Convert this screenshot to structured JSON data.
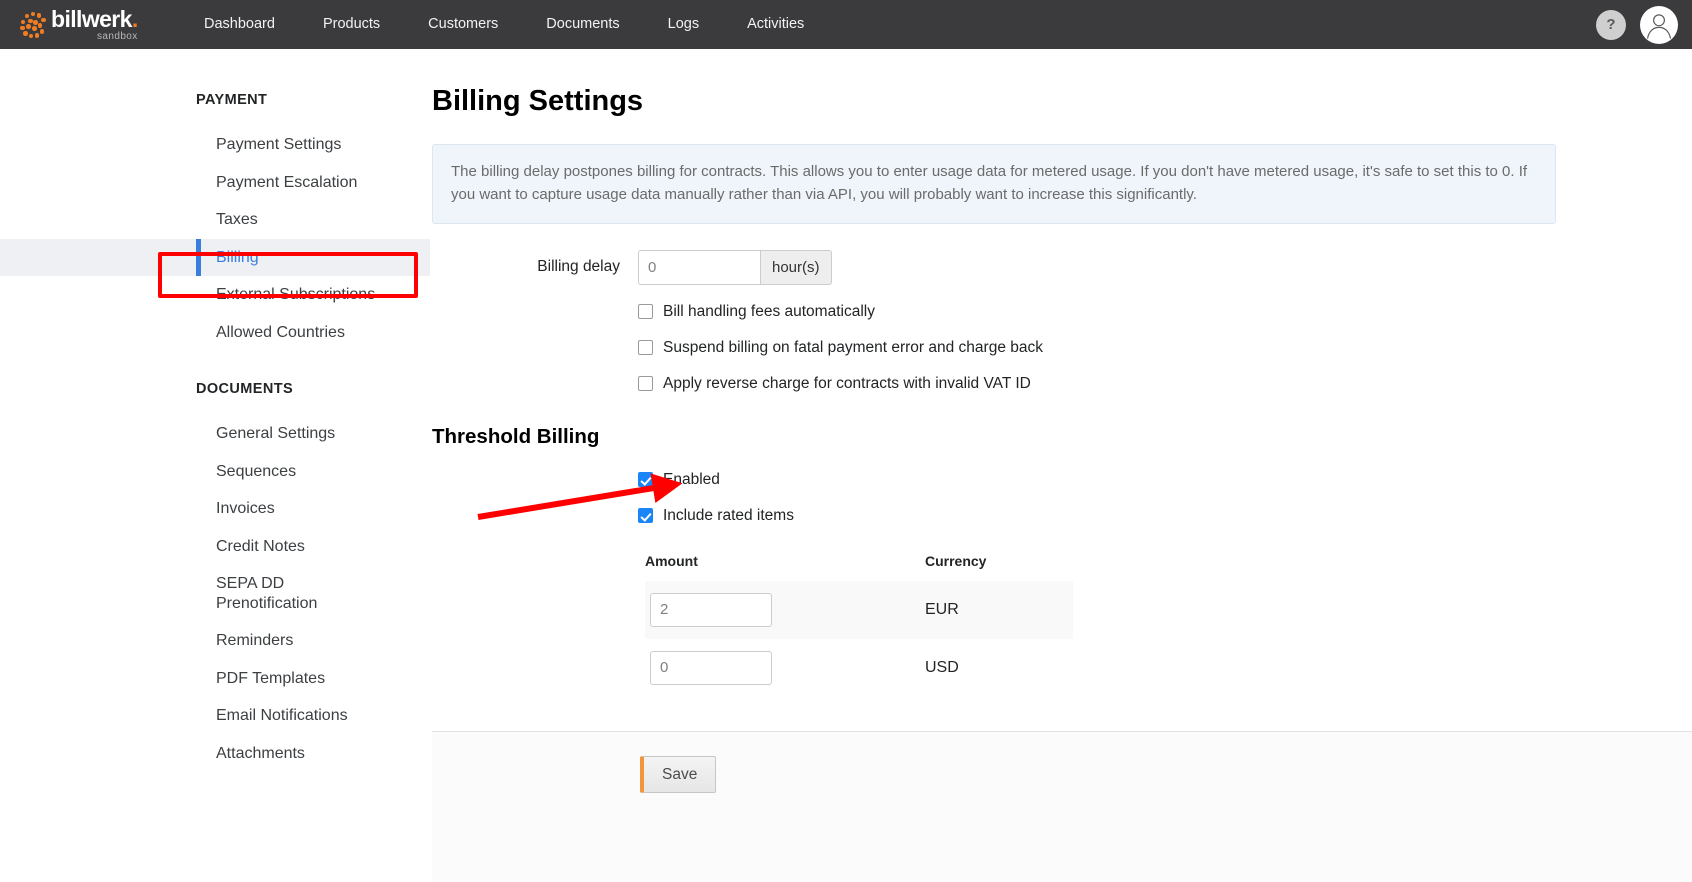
{
  "topnav": {
    "logo": {
      "word": "billwerk",
      "dot": ".",
      "sub": "sandbox",
      "mark": "dot-ring-icon"
    },
    "items": [
      {
        "label": "Dashboard",
        "name": "nav-dashboard"
      },
      {
        "label": "Products",
        "name": "nav-products"
      },
      {
        "label": "Customers",
        "name": "nav-customers"
      },
      {
        "label": "Documents",
        "name": "nav-documents"
      },
      {
        "label": "Logs",
        "name": "nav-logs"
      },
      {
        "label": "Activities",
        "name": "nav-activities"
      }
    ],
    "help_label": "?",
    "help_icon": "question-mark-icon",
    "avatar_icon": "user-avatar-icon",
    "background": "#3b3b3d"
  },
  "sidebar": {
    "groups": [
      {
        "title": "PAYMENT",
        "items": [
          {
            "label": "Payment Settings",
            "active": false
          },
          {
            "label": "Payment Escalation",
            "active": false
          },
          {
            "label": "Taxes",
            "active": false
          },
          {
            "label": "Billing",
            "active": true
          },
          {
            "label": "External Subscriptions",
            "active": false
          },
          {
            "label": "Allowed Countries",
            "active": false
          }
        ]
      },
      {
        "title": "DOCUMENTS",
        "items": [
          {
            "label": "General Settings",
            "active": false
          },
          {
            "label": "Sequences",
            "active": false
          },
          {
            "label": "Invoices",
            "active": false
          },
          {
            "label": "Credit Notes",
            "active": false
          },
          {
            "label": "SEPA DD Prenotification",
            "active": false
          },
          {
            "label": "Reminders",
            "active": false
          },
          {
            "label": "PDF Templates",
            "active": false
          },
          {
            "label": "Email Notifications",
            "active": false
          },
          {
            "label": "Attachments",
            "active": false
          }
        ]
      }
    ],
    "active_color": "#3b7ddd"
  },
  "main": {
    "title": "Billing Settings",
    "info_banner": "The billing delay postpones billing for contracts. This allows you to enter usage data for metered usage. If you don't have metered usage, it's safe to set this to 0. If you want to capture usage data manually rather than via API, you will probably want to increase this significantly.",
    "billing_delay": {
      "label": "Billing delay",
      "value": "0",
      "placeholder": "0",
      "unit": "hour(s)"
    },
    "checkboxes": [
      {
        "label": "Bill handling fees automatically",
        "checked": false,
        "name": "checkbox-bill-handling-fees"
      },
      {
        "label": "Suspend billing on fatal payment error and charge back",
        "checked": false,
        "name": "checkbox-suspend-billing"
      },
      {
        "label": "Apply reverse charge for contracts with invalid VAT ID",
        "checked": false,
        "name": "checkbox-reverse-charge"
      }
    ],
    "threshold": {
      "title": "Threshold Billing",
      "checkboxes": [
        {
          "label": "Enabled",
          "checked": true,
          "name": "checkbox-threshold-enabled"
        },
        {
          "label": "Include rated items",
          "checked": true,
          "name": "checkbox-include-rated-items"
        }
      ],
      "table": {
        "headers": [
          "Amount",
          "Currency"
        ],
        "rows": [
          {
            "amount": "2",
            "amount_placeholder": "2",
            "currency": "EUR",
            "striped": true
          },
          {
            "amount": "0",
            "amount_placeholder": "0",
            "currency": "USD",
            "striped": false
          }
        ]
      }
    },
    "save_label": "Save"
  },
  "annotations": {
    "highlight_rect": {
      "target": "Billing",
      "color": "#ff0000"
    },
    "arrow": {
      "target": "Enabled checkbox",
      "color": "#ff0000"
    }
  }
}
